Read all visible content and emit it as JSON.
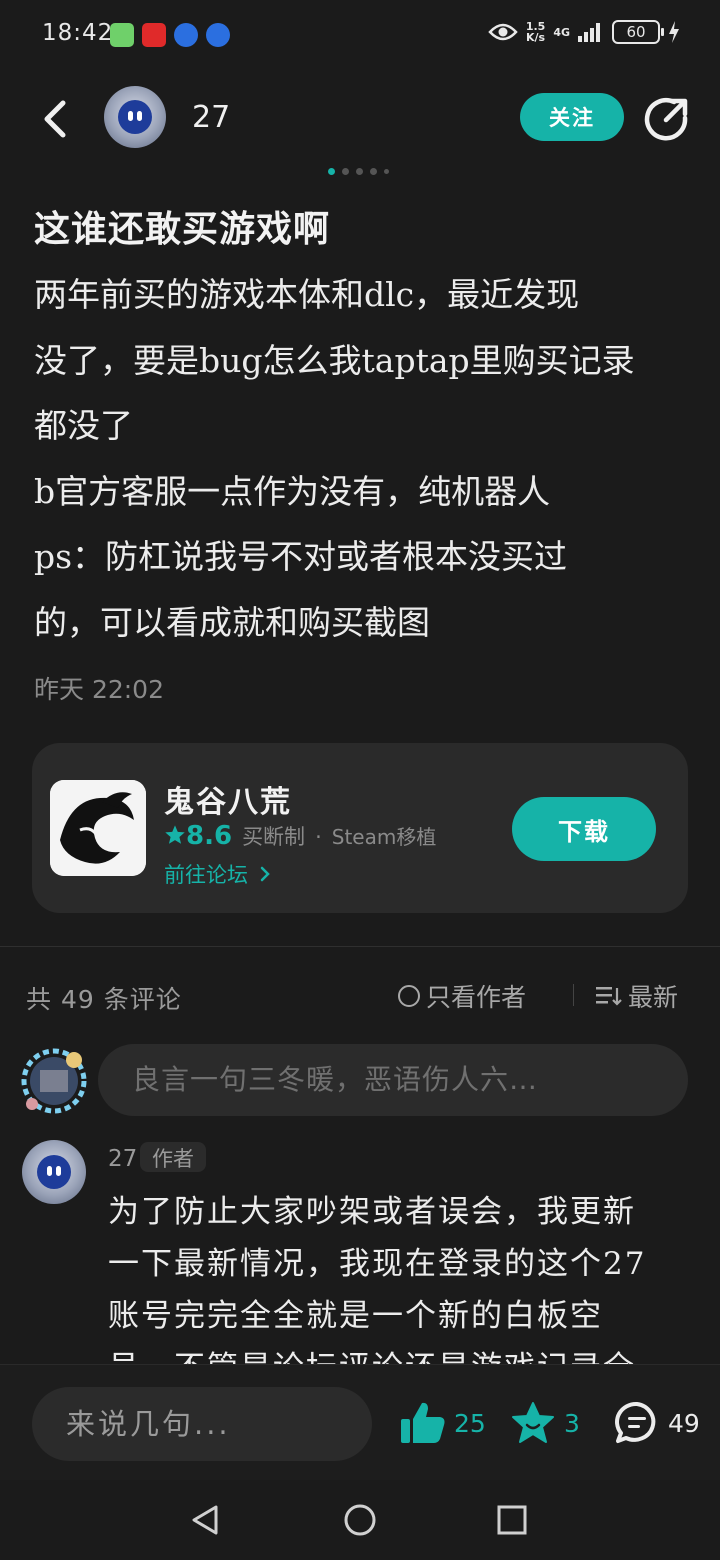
{
  "status_bar": {
    "time": "18:42",
    "network_speed_top": "1.5",
    "network_speed_bottom": "K/s",
    "network_type": "4G",
    "battery": "60"
  },
  "header": {
    "username": "27",
    "follow_label": "关注"
  },
  "post": {
    "title": "这谁还敢买游戏啊",
    "body_lines": [
      "两年前买的游戏本体和dlc，最近发现",
      "没了，要是bug怎么我taptap里购买记录",
      "都没了",
      "b官方客服一点作为没有，纯机器人",
      "ps：防杠说我号不对或者根本没买过",
      "的，可以看成就和购买截图"
    ],
    "time": "昨天 22:02"
  },
  "game_card": {
    "name": "鬼谷八荒",
    "rating": "8.6",
    "purchase_type": "买断制",
    "separator": "·",
    "port": "Steam移植",
    "forum_link": "前往论坛",
    "download_label": "下载"
  },
  "comments": {
    "count_label": "共 49 条评论",
    "author_only_label": "只看作者",
    "sort_label": "最新",
    "input_placeholder": "良言一句三冬暖，恶语伤人六…",
    "items": [
      {
        "name": "27",
        "badge": "作者",
        "lines": [
          "为了防止大家吵架或者误会，我更新",
          "一下最新情况，我现在登录的这个27",
          "账号完完全全就是一个新的白板空",
          "号，不管是论坛评论还是游戏记录全"
        ]
      }
    ]
  },
  "bottom_bar": {
    "reply_placeholder": "来说几句...",
    "likes": "25",
    "favorites": "3",
    "comments": "49"
  },
  "colors": {
    "accent": "#16b3a8",
    "background": "#1b1b1b",
    "card": "#2a2a2a"
  }
}
